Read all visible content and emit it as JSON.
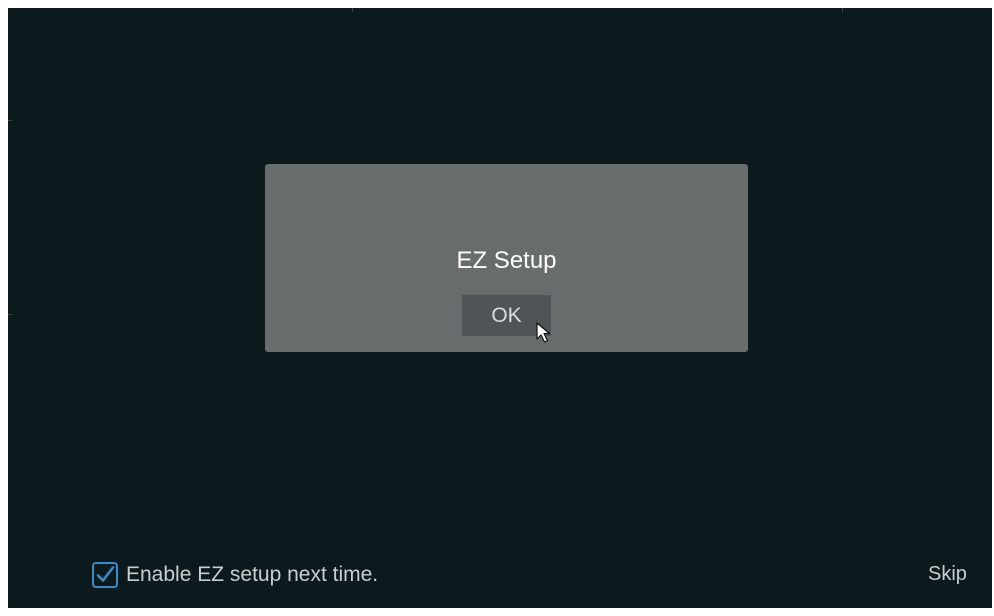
{
  "dialog": {
    "title": "EZ Setup",
    "ok_label": "OK"
  },
  "footer": {
    "enable_label": "Enable EZ setup next time.",
    "enable_checked": true,
    "skip_label": "Skip"
  },
  "colors": {
    "background": "#0c1a1d",
    "dialog": "#676d6c",
    "button": "#4f5556",
    "checkbox_accent": "#3a8cc8"
  },
  "icons": {
    "cursor": "mouse-pointer-icon",
    "check": "checkmark-icon"
  }
}
